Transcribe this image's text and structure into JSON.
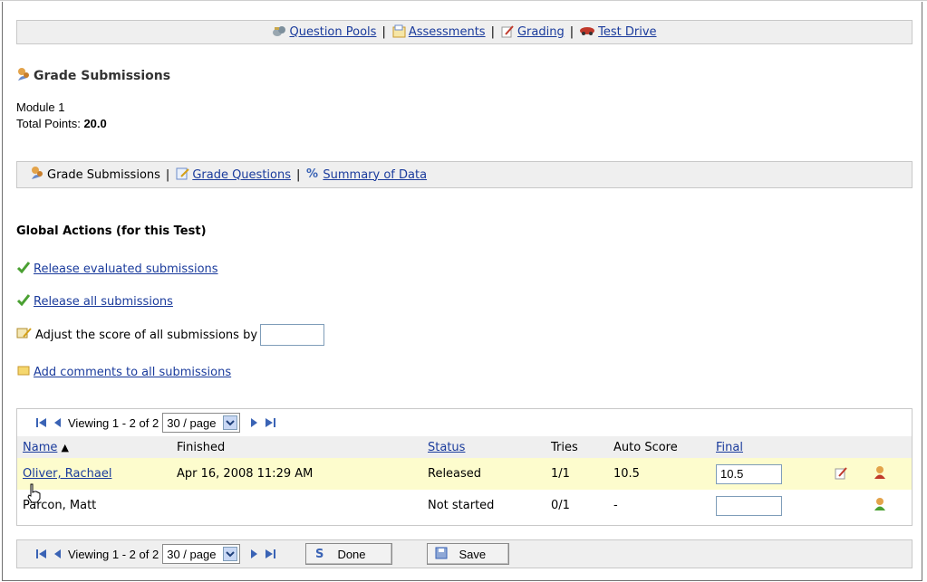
{
  "top_nav": {
    "question_pools": "Question Pools",
    "assessments": "Assessments",
    "grading": "Grading",
    "test_drive": "Test Drive",
    "separator": "|"
  },
  "page": {
    "title": "Grade Submissions",
    "module": "Module 1",
    "total_points_label": "Total Points:",
    "total_points_value": "20.0"
  },
  "sub_nav": {
    "grade_submissions": "Grade Submissions",
    "grade_questions": "Grade Questions",
    "summary_of_data": "Summary of Data",
    "separator": "|"
  },
  "global_actions": {
    "heading": "Global Actions (for this Test)",
    "release_evaluated": "Release evaluated submissions",
    "release_all": "Release all submissions",
    "adjust_score": "Adjust the score of all submissions by",
    "adjust_value": "",
    "add_comments": "Add comments to all submissions"
  },
  "pager": {
    "viewing": "Viewing 1 - 2 of 2",
    "per_page": "30 / page"
  },
  "table": {
    "headers": {
      "name": "Name",
      "finished": "Finished",
      "status": "Status",
      "tries": "Tries",
      "auto_score": "Auto Score",
      "final": "Final"
    },
    "rows": [
      {
        "name": "Oliver, Rachael",
        "finished": "Apr 16, 2008 11:29 AM",
        "status": "Released",
        "tries": "1/1",
        "auto_score": "10.5",
        "final": "10.5"
      },
      {
        "name": "Parcon, Matt",
        "finished": "",
        "status": "Not started",
        "tries": "0/1",
        "auto_score": "-",
        "final": ""
      }
    ]
  },
  "buttons": {
    "done": "Done",
    "save": "Save"
  },
  "colors": {
    "link": "#1a3b9c",
    "highlight_row": "#fdfccd",
    "bar_bg": "#efefef"
  }
}
